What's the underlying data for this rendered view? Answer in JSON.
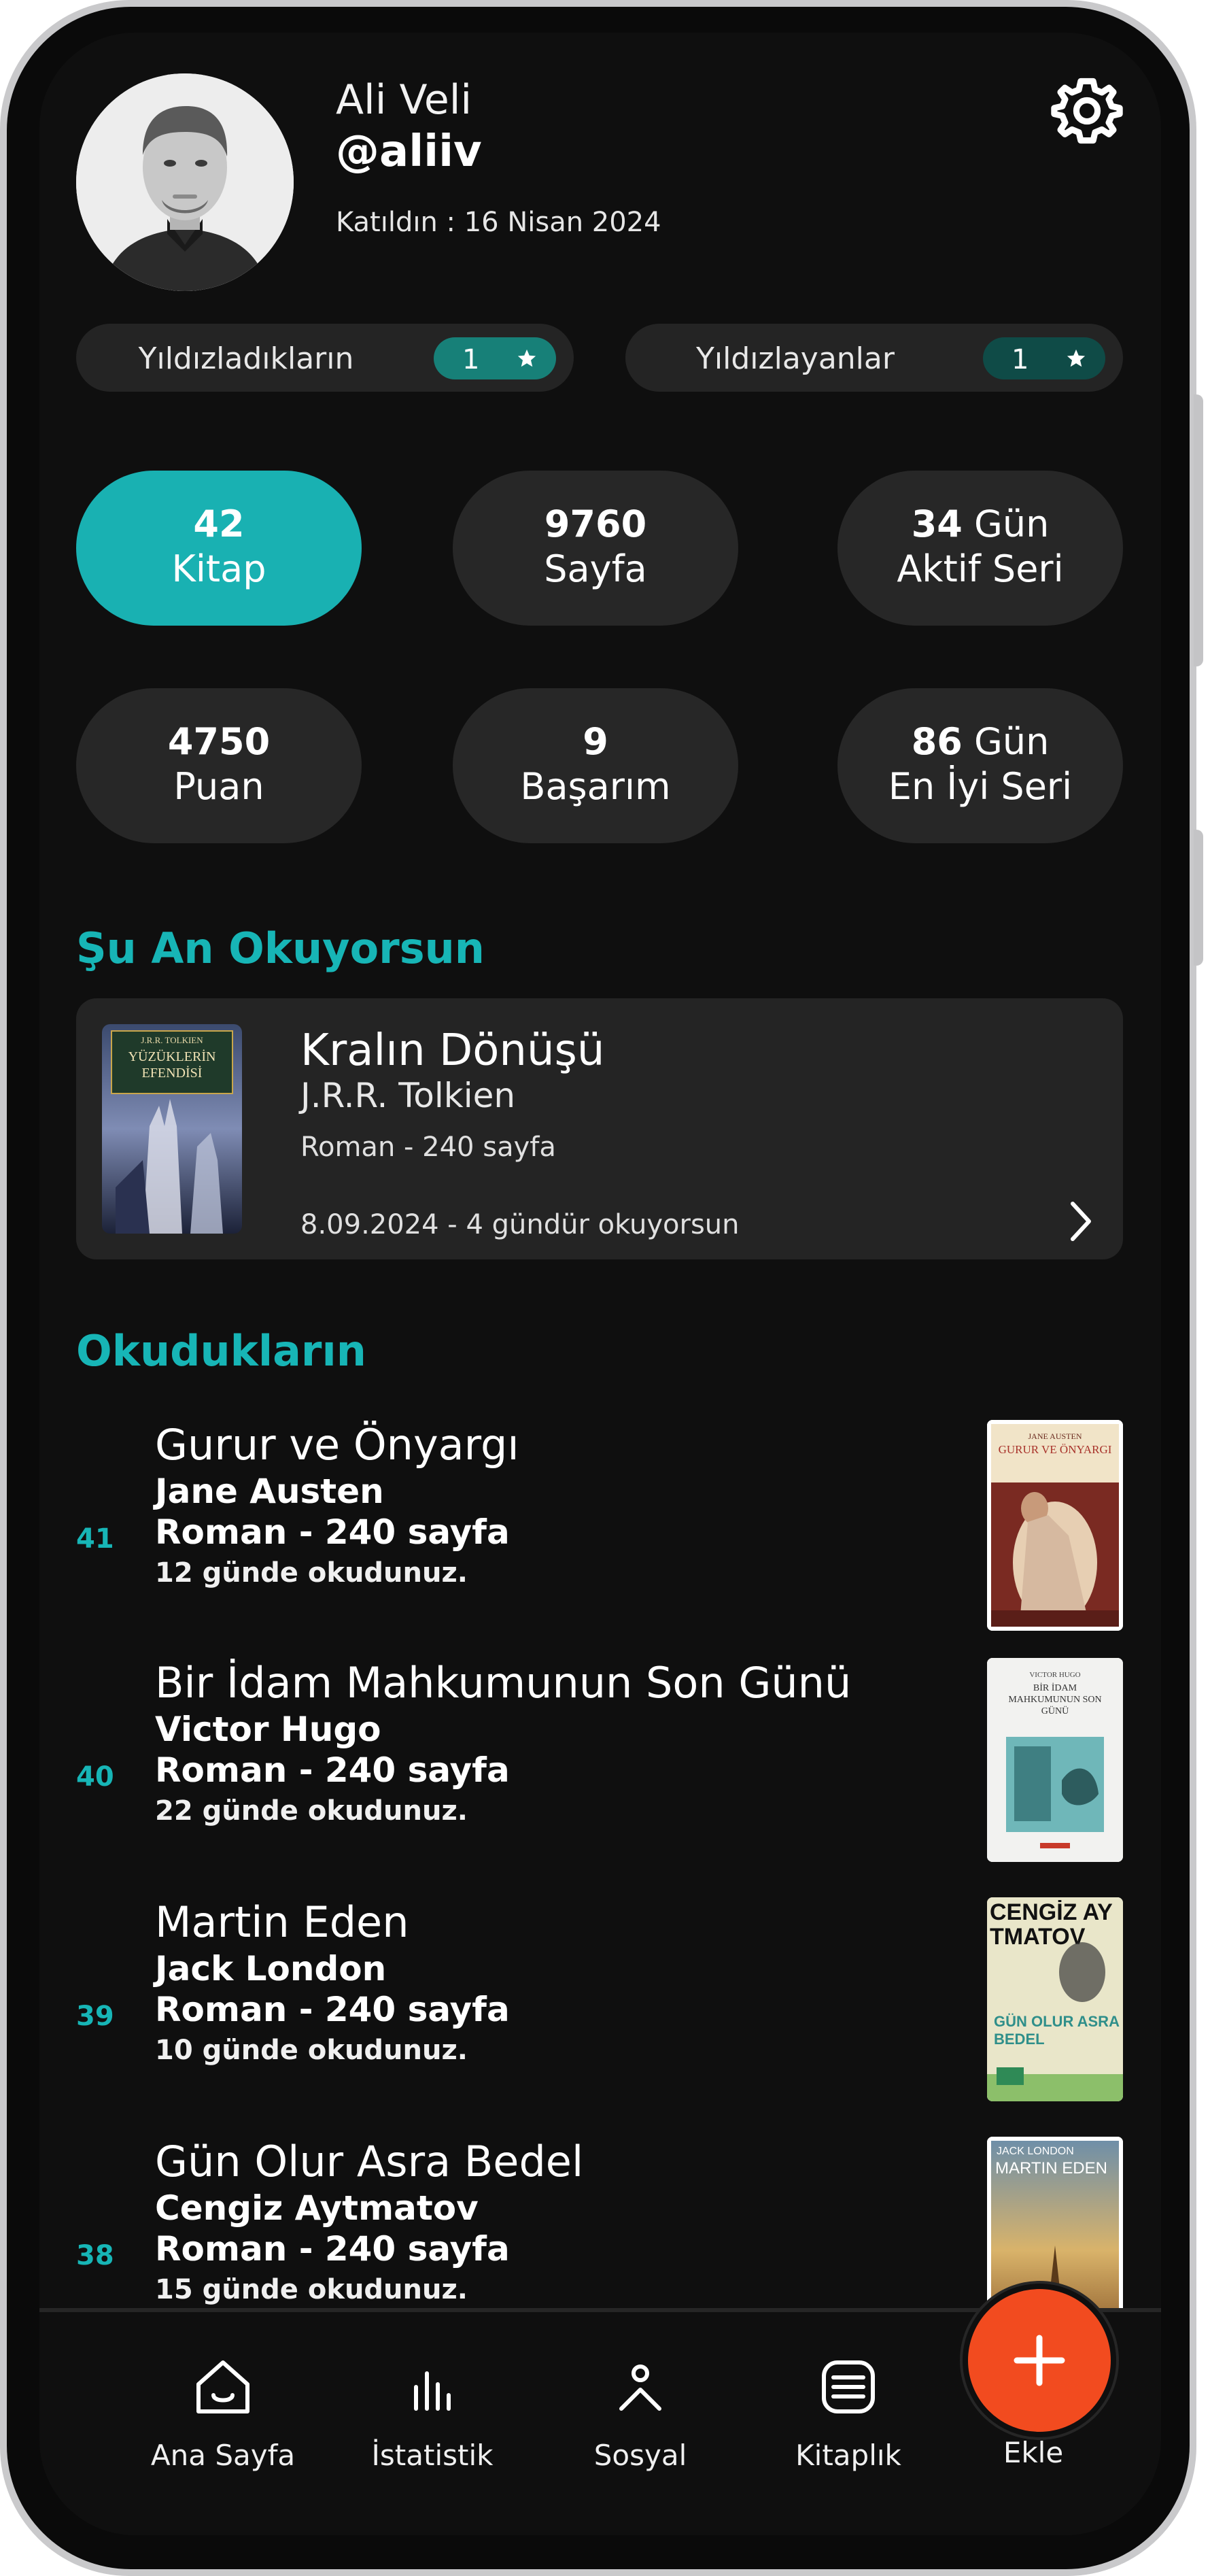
{
  "profile": {
    "name": "Ali Veli",
    "handle": "@aliiv",
    "joined": "Katıldın : 16 Nisan 2024"
  },
  "pills": [
    {
      "label": "Yıldızladıkların",
      "count": "1"
    },
    {
      "label": "Yıldızlayanlar",
      "count": "1"
    }
  ],
  "stats": [
    {
      "value": "42",
      "unit": "",
      "label": "Kitap"
    },
    {
      "value": "9760",
      "unit": "",
      "label": "Sayfa"
    },
    {
      "value": "34",
      "unit": " Gün",
      "label": "Aktif Seri"
    },
    {
      "value": "4750",
      "unit": "",
      "label": "Puan"
    },
    {
      "value": "9",
      "unit": "",
      "label": "Başarım"
    },
    {
      "value": "86",
      "unit": " Gün",
      "label": "En İyi Seri"
    }
  ],
  "current_section_title": "Şu An Okuyorsun",
  "current": {
    "title": "Kralın Dönüşü",
    "author": "J.R.R. Tolkien",
    "meta": "Roman - 240 sayfa",
    "since": "8.09.2024 - 4 gündür okuyorsun",
    "cover_author": "J.R.R. TOLKIEN",
    "cover_title_line1": "YÜZÜKLERİN",
    "cover_title_line2": "EFENDİSİ"
  },
  "read_section_title": "Okudukların",
  "read_books": [
    {
      "num": "41",
      "title": "Gurur ve Önyargı",
      "author": "Jane Austen",
      "meta": "Roman - 240 sayfa",
      "days": "12 günde okudunuz.",
      "cover_top": "JANE AUSTEN",
      "cover_title": "GURUR VE ÖNYARGI"
    },
    {
      "num": "40",
      "title": "Bir İdam Mahkumunun Son Günü",
      "author": "Victor Hugo",
      "meta": "Roman - 240 sayfa",
      "days": "22 günde okudunuz.",
      "cover_top": "VICTOR HUGO",
      "cover_title": "BİR İDAM MAHKUMUNUN SON GÜNÜ"
    },
    {
      "num": "39",
      "title": "Martin Eden",
      "author": "Jack London",
      "meta": "Roman - 240 sayfa",
      "days": "10 günde okudunuz.",
      "cover_top": "CENGİZ AYTMATOV",
      "cover_title": "GÜN OLUR ASRA BEDEL"
    },
    {
      "num": "38",
      "title": "Gün Olur Asra Bedel",
      "author": "Cengiz Aytmatov",
      "meta": "Roman - 240 sayfa",
      "days": "15 günde okudunuz.",
      "cover_top": "JACK LONDON",
      "cover_title": "MARTIN EDEN"
    }
  ],
  "nav": [
    {
      "label": "Ana Sayfa",
      "icon": "home-icon"
    },
    {
      "label": "İstatistik",
      "icon": "stats-icon"
    },
    {
      "label": "Sosyal",
      "icon": "social-icon"
    },
    {
      "label": "Kitaplık",
      "icon": "library-icon"
    },
    {
      "label": "Ekle",
      "icon": "plus-icon"
    }
  ],
  "colors": {
    "accent": "#17b5b6",
    "active_stat": "#19b1b2",
    "fab": "#f24b1f",
    "card": "#242424",
    "background": "#0f0f0f"
  }
}
